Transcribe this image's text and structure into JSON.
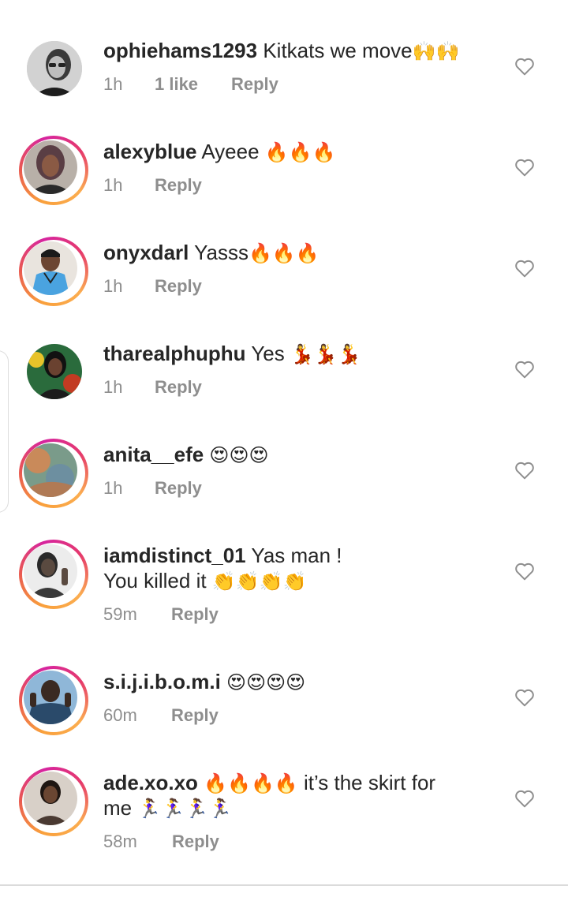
{
  "comments": [
    {
      "username": "ophiehams1293",
      "text": "Kitkats we move",
      "emoji": "🙌🙌",
      "text2": "",
      "emoji2": "",
      "time": "1h",
      "likes": "1 like",
      "reply": "Reply"
    },
    {
      "username": "alexyblue",
      "text": "Ayeee",
      "emoji": "🔥🔥🔥",
      "text2": "",
      "emoji2": "",
      "time": "1h",
      "likes": "",
      "reply": "Reply"
    },
    {
      "username": "onyxdarl",
      "text": "Yasss",
      "emoji": "🔥🔥🔥",
      "text2": "",
      "emoji2": "",
      "time": "1h",
      "likes": "",
      "reply": "Reply"
    },
    {
      "username": "tharealphuphu",
      "text": "Yes",
      "emoji": "💃💃💃",
      "text2": "",
      "emoji2": "",
      "time": "1h",
      "likes": "",
      "reply": "Reply"
    },
    {
      "username": "anita__efe",
      "text": "",
      "emoji": "😍😍😍",
      "text2": "",
      "emoji2": "",
      "time": "1h",
      "likes": "",
      "reply": "Reply"
    },
    {
      "username": "iamdistinct_01",
      "text": "Yas man !",
      "emoji": "",
      "text2": "You killed it",
      "emoji2": "👏👏👏👏",
      "time": "59m",
      "likes": "",
      "reply": "Reply"
    },
    {
      "username": "s.i.j.i.b.o.m.i",
      "text": "",
      "emoji": "😍😍😍😍",
      "text2": "",
      "emoji2": "",
      "time": "60m",
      "likes": "",
      "reply": "Reply"
    },
    {
      "username": "ade.xo.xo",
      "text": "",
      "emoji": "🔥🔥🔥🔥",
      "text_after": "it’s the skirt for",
      "text2": "me",
      "emoji2": "🏃‍♀️🏃‍♀️🏃‍♀️🏃‍♀️",
      "time": "58m",
      "likes": "",
      "reply": "Reply"
    }
  ],
  "colors": {
    "text": "#262626",
    "meta": "#8e8e8e",
    "heart": "#8e8e8e",
    "ring_start": "#f9a03c",
    "ring_end": "#d6249f"
  },
  "icons": {
    "like": "heart-outline-icon"
  }
}
